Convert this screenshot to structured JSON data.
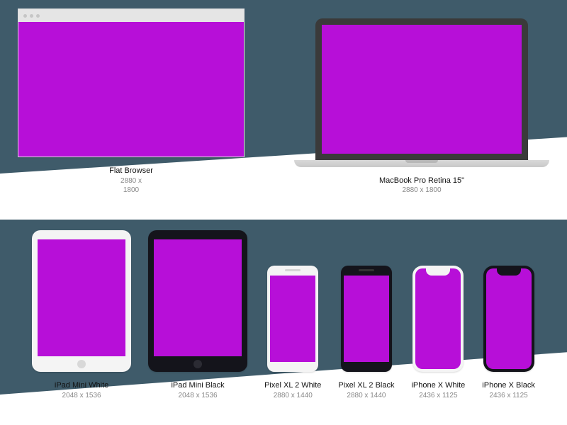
{
  "colors": {
    "screen_fill": "#b70fd8",
    "background_panel": "#3f5b6a"
  },
  "top_row": {
    "browser": {
      "name": "Flat Browser",
      "resolution": "2880 x",
      "resolution2": "1800"
    },
    "macbook": {
      "name": "MacBook Pro Retina 15\"",
      "resolution": "2880 x 1800"
    }
  },
  "bottom_row": [
    {
      "key": "ipad-mini-white",
      "name": "iPad Mini White",
      "resolution": "2048 x 1536"
    },
    {
      "key": "ipad-mini-black",
      "name": "iPad Mini Black",
      "resolution": "2048 x 1536"
    },
    {
      "key": "pixel-xl2-white",
      "name": "Pixel XL 2 White",
      "resolution": "2880 x 1440"
    },
    {
      "key": "pixel-xl2-black",
      "name": "Pixel XL 2 Black",
      "resolution": "2880 x 1440"
    },
    {
      "key": "iphone-x-white",
      "name": "iPhone X White",
      "resolution": "2436 x 1125"
    },
    {
      "key": "iphone-x-black",
      "name": "iPhone X Black",
      "resolution": "2436 x 1125"
    }
  ]
}
